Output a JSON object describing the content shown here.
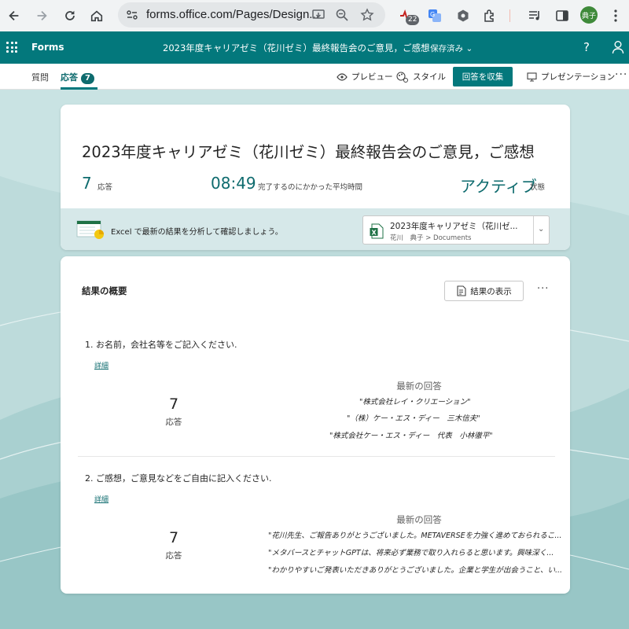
{
  "browser": {
    "url": "forms.office.com/Pages/Design...",
    "extension_badge": "22",
    "profile_initials": "典子"
  },
  "header": {
    "app_name": "Forms",
    "doc_title": "2023年度キャリアゼミ（花川ゼミ）最終報告会のご意見，ご感想",
    "saved_status": "- 保存済み",
    "help": "?"
  },
  "tabs": {
    "questions": "質問",
    "responses": "応答",
    "responses_count": "7"
  },
  "commands": {
    "preview": "プレビュー",
    "style": "スタイル",
    "collect": "回答を収集",
    "present": "プレゼンテーション",
    "more": "···"
  },
  "summary": {
    "title": "2023年度キャリアゼミ（花川ゼミ）最終報告会のご意見，ご感想",
    "responses_value": "7",
    "responses_label": "応答",
    "avg_time_value": "08:49",
    "avg_time_label": "完了するのにかかった平均時間",
    "status_value": "アクティブ",
    "status_label": "状態",
    "excel_message": "Excel で最新の結果を分析して確認しましょう。",
    "file_name": "2023年度キャリアゼミ（花川ゼ...",
    "file_path": "花川　典子 > Documents"
  },
  "results": {
    "section_title": "結果の概要",
    "view_results": "結果の表示",
    "more": "···",
    "questions": [
      {
        "question": "1. お名前，会社名等をご記入ください.",
        "details": "詳細",
        "count": "7",
        "count_label": "応答",
        "latest_title": "最新の回答",
        "latest": [
          "\"株式会社レイ・クリエーション\"",
          "\"（株）ケー・エス・ディー　三木信夫\"",
          "\"株式会社ケー・エス・ディー　代表　小林徹平\""
        ]
      },
      {
        "question": "2. ご感想，ご意見などをご自由に記入ください.",
        "details": "詳細",
        "count": "7",
        "count_label": "応答",
        "latest_title": "最新の回答",
        "latest": [
          "\"花川先生、ご報告ありがとうございました。METAVERSEを力強く進めておられるこ...",
          "\"メタバースとチャットGPTは、将来必ず業務で取り入れらると思います。興味深く...",
          "\"わかりやすいご発表いただきありがとうございました。企業と学生が出会うこと、い..."
        ]
      }
    ]
  },
  "colors": {
    "brand": "#03787c",
    "accent_text": "#0e6b6e",
    "background": "#b9d8d8"
  }
}
